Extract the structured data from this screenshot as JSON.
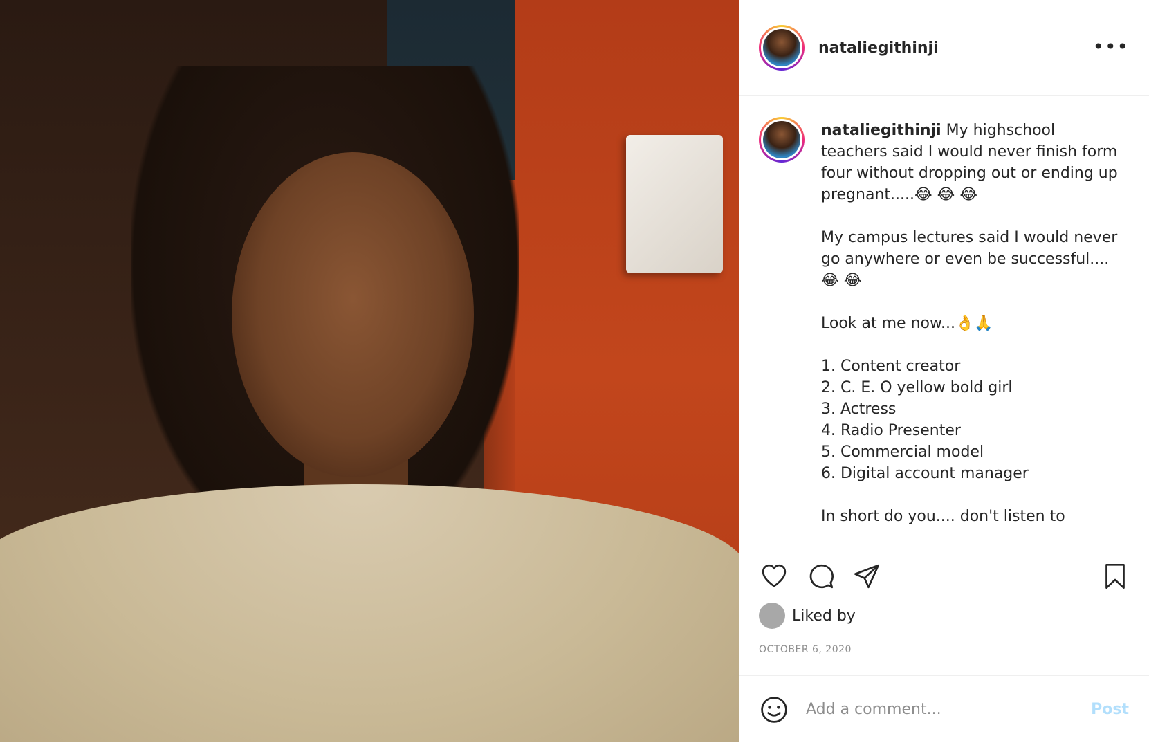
{
  "post": {
    "username": "nataliegithinji",
    "more_icon": "more-horizontal-icon",
    "caption": {
      "username": "nataliegithinji",
      "line1": "My highschool teachers said I would never finish form four without dropping out or ending up pregnant.....😂 😂 😂",
      "line2": "My campus lectures said I would never go anywhere or even be successful.... 😂 😂",
      "line3": "Look at me now...👌🙏",
      "list": [
        "1. Content creator",
        "2. C. E. O yellow bold girl",
        "3. Actress",
        "4. Radio Presenter",
        "5. Commercial model",
        "6. Digital account manager"
      ],
      "line4": "In short do you.... don't listen to"
    },
    "actions": {
      "like_icon": "heart-icon",
      "comment_icon": "comment-icon",
      "share_icon": "send-icon",
      "save_icon": "bookmark-icon"
    },
    "liked_by": "Liked by",
    "date": "OCTOBER 6, 2020",
    "comment_placeholder": "Add a comment...",
    "post_label": "Post"
  },
  "colors": {
    "post_button_disabled": "#b2dffc",
    "muted_text": "#8e8e8e",
    "text": "#262626"
  }
}
